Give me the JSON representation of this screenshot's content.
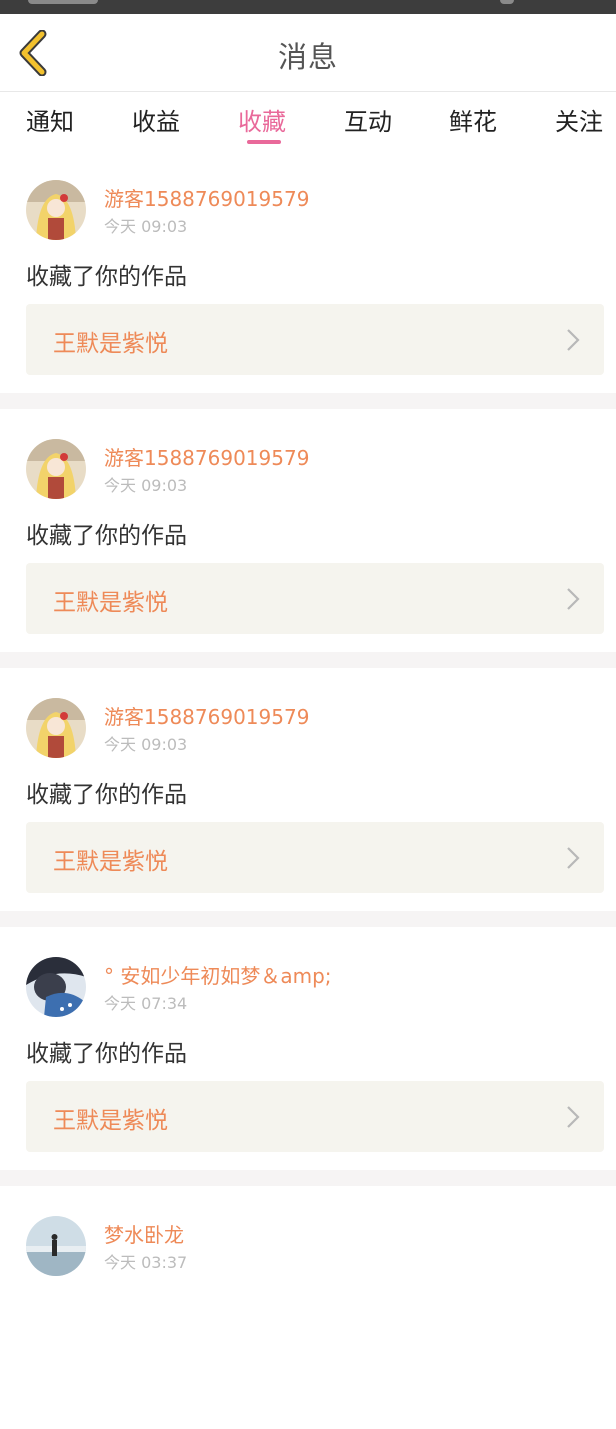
{
  "header": {
    "title": "消息",
    "back_icon": "chevron-left-icon",
    "accent_color": "#e9699a",
    "back_color": "#f2c12e"
  },
  "tabs": [
    {
      "label": "通知",
      "active": false
    },
    {
      "label": "收益",
      "active": false
    },
    {
      "label": "收藏",
      "active": true
    },
    {
      "label": "互动",
      "active": false
    },
    {
      "label": "鲜花",
      "active": false
    },
    {
      "label": "关注",
      "active": false
    }
  ],
  "messages": [
    {
      "user": "游客1588769019579",
      "time": "今天 09:03",
      "action": "收藏了你的作品",
      "work": "王默是紫悦",
      "avatar": "anime-girl"
    },
    {
      "user": "游客1588769019579",
      "time": "今天 09:03",
      "action": "收藏了你的作品",
      "work": "王默是紫悦",
      "avatar": "anime-girl"
    },
    {
      "user": "游客1588769019579",
      "time": "今天 09:03",
      "action": "收藏了你的作品",
      "work": "王默是紫悦",
      "avatar": "anime-girl"
    },
    {
      "user": "° 安如少年初如梦＆amp;",
      "time": "今天 07:34",
      "action": "收藏了你的作品",
      "work": "王默是紫悦",
      "avatar": "dark-figure"
    },
    {
      "user": "梦水卧龙",
      "time": "今天 03:37",
      "action": "",
      "work": "",
      "avatar": "beach-person"
    }
  ]
}
